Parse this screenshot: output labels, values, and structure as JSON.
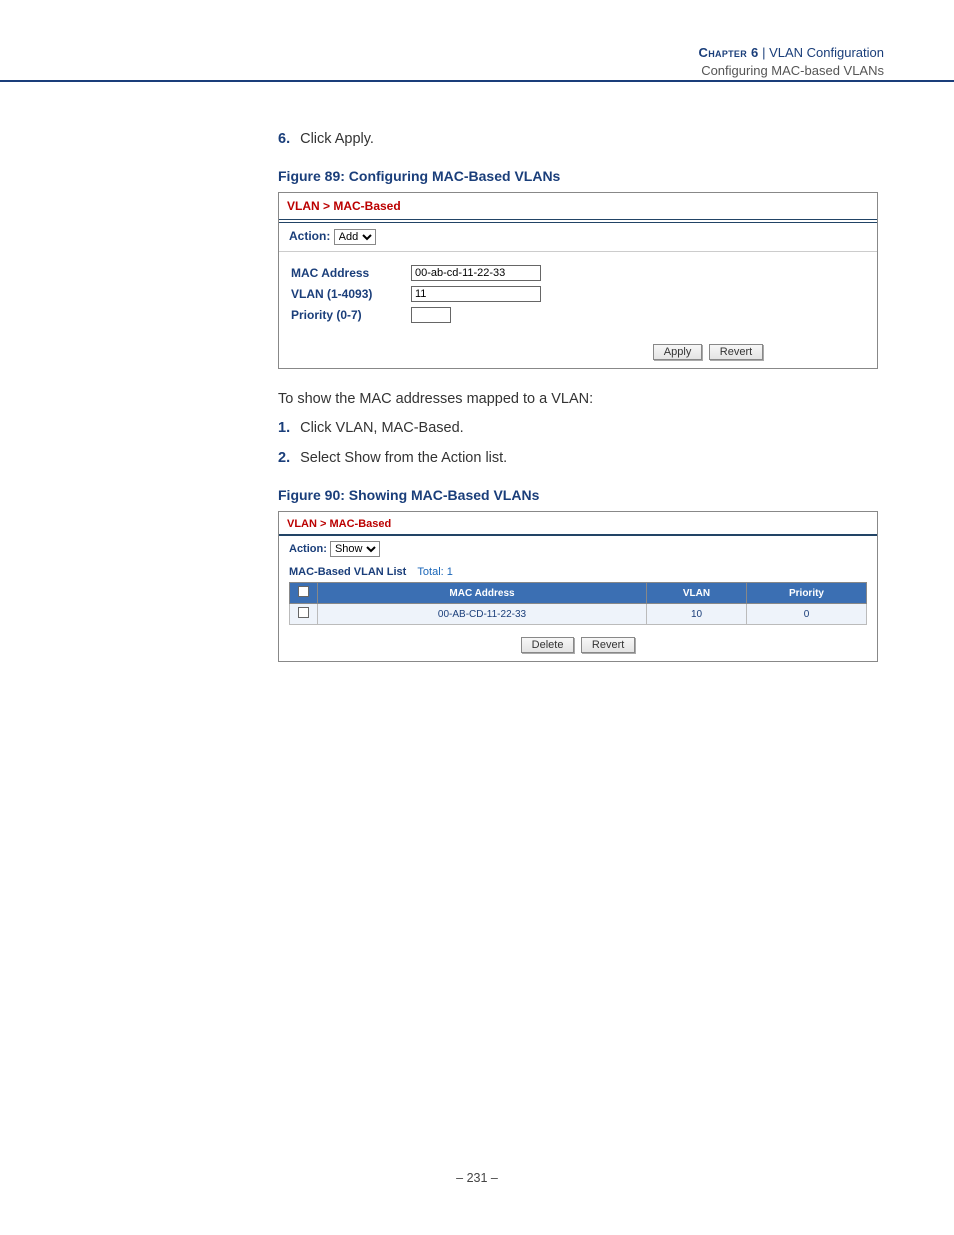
{
  "header": {
    "chapter_label": "Chapter 6",
    "sep": "  |  ",
    "chapter_title": "VLAN Configuration",
    "section_title": "Configuring MAC-based VLANs"
  },
  "step6": {
    "num": "6.",
    "text": "Click Apply."
  },
  "fig89": {
    "caption": "Figure 89:  Configuring MAC-Based VLANs",
    "breadcrumb": "VLAN > MAC-Based",
    "action_label": "Action:",
    "action_value": "Add",
    "mac_label": "MAC Address",
    "mac_value": "00-ab-cd-11-22-33",
    "vlan_label": "VLAN (1-4093)",
    "vlan_value": "11",
    "prio_label": "Priority (0-7)",
    "prio_value": "",
    "apply": "Apply",
    "revert": "Revert"
  },
  "para_show": "To show the MAC addresses mapped to a VLAN:",
  "step1": {
    "num": "1.",
    "text": "Click VLAN, MAC-Based."
  },
  "step2": {
    "num": "2.",
    "text": "Select Show from the Action list."
  },
  "fig90": {
    "caption": "Figure 90:  Showing MAC-Based VLANs",
    "breadcrumb": "VLAN > MAC-Based",
    "action_label": "Action:",
    "action_value": "Show",
    "list_title": "MAC-Based VLAN List",
    "list_total": "Total: 1",
    "cols": {
      "mac": "MAC Address",
      "vlan": "VLAN",
      "prio": "Priority"
    },
    "rows": [
      {
        "mac": "00-AB-CD-11-22-33",
        "vlan": "10",
        "prio": "0"
      }
    ],
    "delete": "Delete",
    "revert": "Revert"
  },
  "footer": "–  231  –"
}
